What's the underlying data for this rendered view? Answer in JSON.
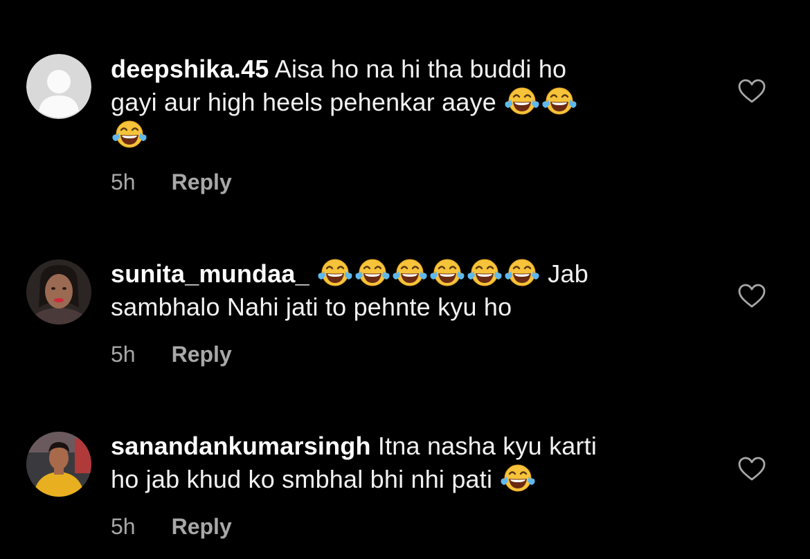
{
  "colors": {
    "background": "#000000",
    "text": "#f2f2f2",
    "secondary": "#a8a8a8"
  },
  "comments": [
    {
      "username": "deepshika.45",
      "text_1": "Aisa ho na hi tha buddi ho",
      "text_2": "gayi aur high heels pehenkar aaye",
      "time": "5h",
      "reply": "Reply",
      "avatar": "default-avatar-icon",
      "emoji": "face-with-tears-of-joy"
    },
    {
      "username": "sunita_mundaa_",
      "text_1": "Jab",
      "text_2": "sambhalo Nahi jati to pehnte kyu ho",
      "time": "5h",
      "reply": "Reply",
      "avatar": "user-photo",
      "emoji": "face-with-tears-of-joy"
    },
    {
      "username": "sanandankumarsingh",
      "text_1": "Itna nasha kyu karti",
      "text_2": "ho jab khud ko smbhal bhi nhi pati",
      "time": "5h",
      "reply": "Reply",
      "avatar": "user-photo",
      "emoji": "face-with-tears-of-joy"
    }
  ]
}
